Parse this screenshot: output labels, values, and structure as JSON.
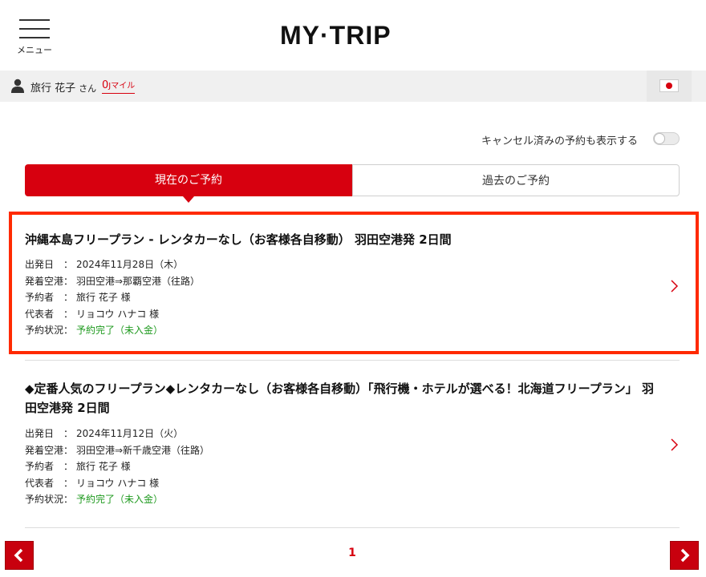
{
  "header": {
    "menu_label": "メニュー",
    "logo": "MY·TRIP"
  },
  "user": {
    "name": "旅行 花子",
    "suffix": "さん",
    "miles_value": "0",
    "miles_unit": "Jマイル"
  },
  "filter": {
    "show_cancelled_label": "キャンセル済みの予約も表示する",
    "show_cancelled_on": false
  },
  "tabs": [
    {
      "label": "現在のご予約",
      "active": true
    },
    {
      "label": "過去のご予約",
      "active": false
    }
  ],
  "detail_labels": {
    "departure_date": "出発日　：",
    "airports": "発着空港：",
    "booker": "予約者　：",
    "representative": "代表者　：",
    "status": "予約状況："
  },
  "reservations": [
    {
      "title": "沖縄本島フリープラン - レンタカーなし（お客様各自移動） 羽田空港発 2日間",
      "departure_date": "2024年11月28日（木）",
      "airports": "羽田空港⇒那覇空港（往路）",
      "booker": "旅行 花子 様",
      "representative": "リョコウ ハナコ 様",
      "status": "予約完了（未入金）"
    },
    {
      "title": "◆定番人気のフリープラン◆レンタカーなし（お客様各自移動）「飛行機・ホテルが選べる！北海道フリープラン」 羽田空港発 2日間",
      "departure_date": "2024年11月12日（火）",
      "airports": "羽田空港⇒新千歳空港（往路）",
      "booker": "旅行 花子 様",
      "representative": "リョコウ ハナコ 様",
      "status": "予約完了（未入金）"
    }
  ],
  "pagination": {
    "current_page": "1"
  },
  "colors": {
    "accent": "#d7000f",
    "status_green": "#1f9a1f",
    "highlight": "#ff2a00"
  }
}
